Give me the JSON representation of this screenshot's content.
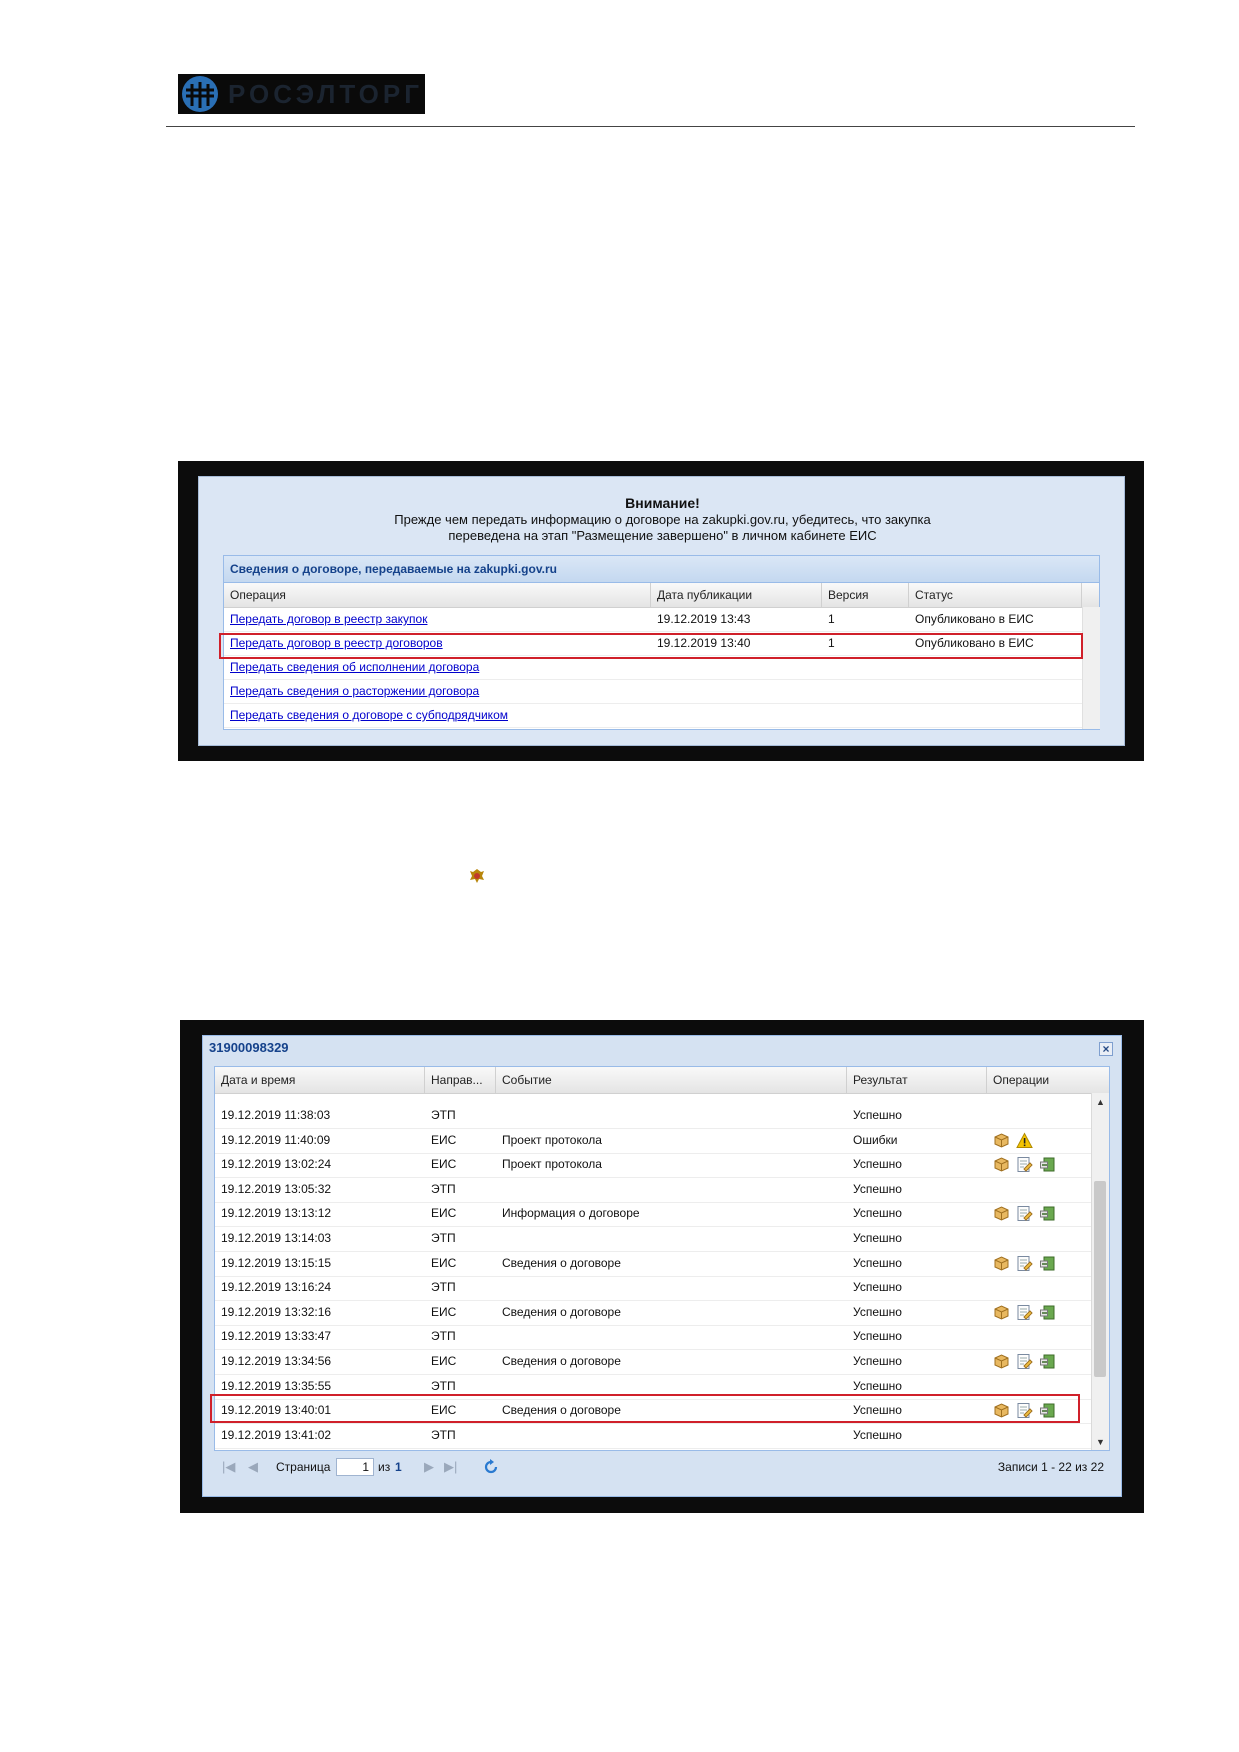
{
  "header": {
    "logo_text": "РОСЭЛТОРГ"
  },
  "screen1": {
    "warning_title": "Внимание!",
    "warning_line1": "Прежде чем передать информацию о договоре на zakupki.gov.ru, убедитесь, что закупка",
    "warning_line2": "переведена на этап \"Размещение завершено\" в личном кабинете ЕИС",
    "grid_title": "Сведения о договоре, передаваемые на zakupki.gov.ru",
    "columns": [
      "Операция",
      "Дата публикации",
      "Версия",
      "Статус"
    ],
    "rows": [
      {
        "op": "Передать договор в реестр закупок",
        "date": "19.12.2019 13:43",
        "ver": "1",
        "status": "Опубликовано в ЕИС"
      },
      {
        "op": "Передать договор в реестр договоров",
        "date": "19.12.2019 13:40",
        "ver": "1",
        "status": "Опубликовано в ЕИС"
      },
      {
        "op": "Передать сведения об исполнении договора",
        "date": "",
        "ver": "",
        "status": ""
      },
      {
        "op": "Передать сведения о расторжении договора",
        "date": "",
        "ver": "",
        "status": ""
      },
      {
        "op": "Передать сведения о договоре с субподрядчиком",
        "date": "",
        "ver": "",
        "status": ""
      }
    ]
  },
  "screen2": {
    "window_title": "31900098329",
    "close_label": "×",
    "columns": [
      "Дата и время",
      "Направ...",
      "Событие",
      "Результат",
      "Операции"
    ],
    "rows": [
      {
        "dt": "19.12.2019 11:38:03",
        "dir": "ЭТП",
        "event": "",
        "result": "Успешно",
        "ops": []
      },
      {
        "dt": "19.12.2019 11:40:09",
        "dir": "ЕИС",
        "event": "Проект протокола",
        "result": "Ошибки",
        "ops": [
          "package-icon",
          "warning-icon"
        ]
      },
      {
        "dt": "19.12.2019 13:02:24",
        "dir": "ЕИС",
        "event": "Проект протокола",
        "result": "Успешно",
        "ops": [
          "package-icon",
          "document-edit-icon",
          "export-icon"
        ]
      },
      {
        "dt": "19.12.2019 13:05:32",
        "dir": "ЭТП",
        "event": "",
        "result": "Успешно",
        "ops": []
      },
      {
        "dt": "19.12.2019 13:13:12",
        "dir": "ЕИС",
        "event": "Информация о договоре",
        "result": "Успешно",
        "ops": [
          "package-icon",
          "document-edit-icon",
          "export-icon"
        ]
      },
      {
        "dt": "19.12.2019 13:14:03",
        "dir": "ЭТП",
        "event": "",
        "result": "Успешно",
        "ops": []
      },
      {
        "dt": "19.12.2019 13:15:15",
        "dir": "ЕИС",
        "event": "Сведения о договоре",
        "result": "Успешно",
        "ops": [
          "package-icon",
          "document-edit-icon",
          "export-icon"
        ]
      },
      {
        "dt": "19.12.2019 13:16:24",
        "dir": "ЭТП",
        "event": "",
        "result": "Успешно",
        "ops": []
      },
      {
        "dt": "19.12.2019 13:32:16",
        "dir": "ЕИС",
        "event": "Сведения о договоре",
        "result": "Успешно",
        "ops": [
          "package-icon",
          "document-edit-icon",
          "export-icon"
        ]
      },
      {
        "dt": "19.12.2019 13:33:47",
        "dir": "ЭТП",
        "event": "",
        "result": "Успешно",
        "ops": []
      },
      {
        "dt": "19.12.2019 13:34:56",
        "dir": "ЕИС",
        "event": "Сведения о договоре",
        "result": "Успешно",
        "ops": [
          "package-icon",
          "document-edit-icon",
          "export-icon"
        ]
      },
      {
        "dt": "19.12.2019 13:35:55",
        "dir": "ЭТП",
        "event": "",
        "result": "Успешно",
        "ops": []
      },
      {
        "dt": "19.12.2019 13:40:01",
        "dir": "ЕИС",
        "event": "Сведения о договоре",
        "result": "Успешно",
        "ops": [
          "package-icon",
          "document-edit-icon",
          "export-icon"
        ]
      },
      {
        "dt": "19.12.2019 13:41:02",
        "dir": "ЭТП",
        "event": "",
        "result": "Успешно",
        "ops": []
      }
    ],
    "pager": {
      "page_label": "Страница",
      "page_value": "1",
      "of_label": "из",
      "total_pages": "1",
      "records": "Записи 1 - 22 из 22"
    }
  },
  "colors": {
    "highlight": "#d0202a",
    "link": "#0000cc",
    "header_blue": "#15428b"
  }
}
